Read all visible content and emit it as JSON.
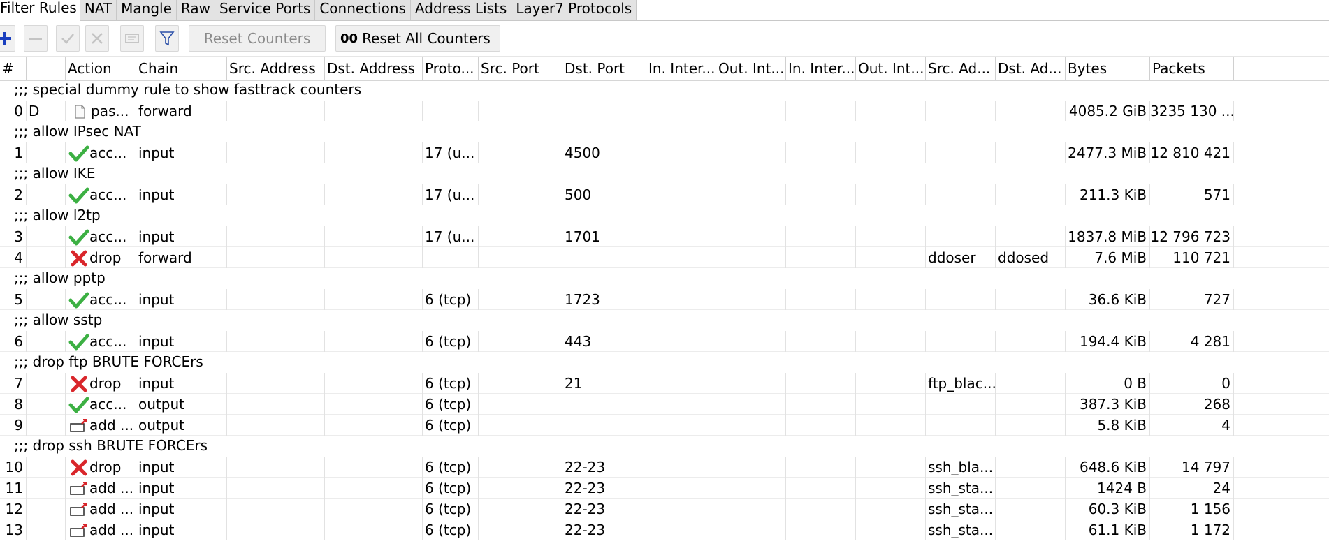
{
  "tabs": [
    "Filter Rules",
    "NAT",
    "Mangle",
    "Raw",
    "Service Ports",
    "Connections",
    "Address Lists",
    "Layer7 Protocols"
  ],
  "toolbar": {
    "reset_counters": "Reset Counters",
    "reset_all_counters_prefix": "00",
    "reset_all_counters": "Reset All Counters"
  },
  "columns": [
    "#",
    "",
    "Action",
    "Chain",
    "Src. Address",
    "Dst. Address",
    "Proto...",
    "Src. Port",
    "Dst. Port",
    "In. Inter...",
    "Out. Int...",
    "In. Inter...",
    "Out. Int...",
    "Src. Ad...",
    "Dst. Ad...",
    "Bytes",
    "Packets"
  ],
  "rows": [
    {
      "kind": "comment",
      "text": ";;; special dummy rule to show fasttrack counters"
    },
    {
      "kind": "rule",
      "num": "0",
      "flag": "D",
      "icon": "passthrough-icon",
      "action": "pas...",
      "chain": "forward",
      "proto": "",
      "dst_port": "",
      "src_list": "",
      "dst_list": "",
      "bytes": "4085.2 GiB",
      "packets": "3235 130 ...",
      "sep": true
    },
    {
      "kind": "comment",
      "text": ";;; allow IPsec NAT"
    },
    {
      "kind": "rule",
      "num": "1",
      "flag": "",
      "icon": "accept-icon",
      "action": "acc...",
      "chain": "input",
      "proto": "17 (u...",
      "dst_port": "4500",
      "src_list": "",
      "dst_list": "",
      "bytes": "2477.3 MiB",
      "packets": "12 810 421"
    },
    {
      "kind": "comment",
      "text": ";;; allow IKE"
    },
    {
      "kind": "rule",
      "num": "2",
      "flag": "",
      "icon": "accept-icon",
      "action": "acc...",
      "chain": "input",
      "proto": "17 (u...",
      "dst_port": "500",
      "src_list": "",
      "dst_list": "",
      "bytes": "211.3 KiB",
      "packets": "571"
    },
    {
      "kind": "comment",
      "text": ";;; allow l2tp"
    },
    {
      "kind": "rule",
      "num": "3",
      "flag": "",
      "icon": "accept-icon",
      "action": "acc...",
      "chain": "input",
      "proto": "17 (u...",
      "dst_port": "1701",
      "src_list": "",
      "dst_list": "",
      "bytes": "1837.8 MiB",
      "packets": "12 796 723"
    },
    {
      "kind": "rule",
      "num": "4",
      "flag": "",
      "icon": "drop-icon",
      "action": "drop",
      "chain": "forward",
      "proto": "",
      "dst_port": "",
      "src_list": "ddoser",
      "dst_list": "ddosed",
      "bytes": "7.6 MiB",
      "packets": "110 721"
    },
    {
      "kind": "comment",
      "text": ";;; allow pptp"
    },
    {
      "kind": "rule",
      "num": "5",
      "flag": "",
      "icon": "accept-icon",
      "action": "acc...",
      "chain": "input",
      "proto": "6 (tcp)",
      "dst_port": "1723",
      "src_list": "",
      "dst_list": "",
      "bytes": "36.6 KiB",
      "packets": "727"
    },
    {
      "kind": "comment",
      "text": ";;; allow sstp"
    },
    {
      "kind": "rule",
      "num": "6",
      "flag": "",
      "icon": "accept-icon",
      "action": "acc...",
      "chain": "input",
      "proto": "6 (tcp)",
      "dst_port": "443",
      "src_list": "",
      "dst_list": "",
      "bytes": "194.4 KiB",
      "packets": "4 281"
    },
    {
      "kind": "comment",
      "text": ";;; drop ftp BRUTE FORCErs"
    },
    {
      "kind": "rule",
      "num": "7",
      "flag": "",
      "icon": "drop-icon",
      "action": "drop",
      "chain": "input",
      "proto": "6 (tcp)",
      "dst_port": "21",
      "src_list": "ftp_blac...",
      "dst_list": "",
      "bytes": "0 B",
      "packets": "0"
    },
    {
      "kind": "rule",
      "num": "8",
      "flag": "",
      "icon": "accept-icon",
      "action": "acc...",
      "chain": "output",
      "proto": "6 (tcp)",
      "dst_port": "",
      "src_list": "",
      "dst_list": "",
      "bytes": "387.3 KiB",
      "packets": "268"
    },
    {
      "kind": "rule",
      "num": "9",
      "flag": "",
      "icon": "add-to-list-icon",
      "action": "add ...",
      "chain": "output",
      "proto": "6 (tcp)",
      "dst_port": "",
      "src_list": "",
      "dst_list": "",
      "bytes": "5.8 KiB",
      "packets": "4"
    },
    {
      "kind": "comment",
      "text": ";;; drop ssh BRUTE FORCErs"
    },
    {
      "kind": "rule",
      "num": "10",
      "flag": "",
      "icon": "drop-icon",
      "action": "drop",
      "chain": "input",
      "proto": "6 (tcp)",
      "dst_port": "22-23",
      "src_list": "ssh_bla...",
      "dst_list": "",
      "bytes": "648.6 KiB",
      "packets": "14 797"
    },
    {
      "kind": "rule",
      "num": "11",
      "flag": "",
      "icon": "add-to-list-icon",
      "action": "add ...",
      "chain": "input",
      "proto": "6 (tcp)",
      "dst_port": "22-23",
      "src_list": "ssh_sta...",
      "dst_list": "",
      "bytes": "1424 B",
      "packets": "24"
    },
    {
      "kind": "rule",
      "num": "12",
      "flag": "",
      "icon": "add-to-list-icon",
      "action": "add ...",
      "chain": "input",
      "proto": "6 (tcp)",
      "dst_port": "22-23",
      "src_list": "ssh_sta...",
      "dst_list": "",
      "bytes": "60.3 KiB",
      "packets": "1 156"
    },
    {
      "kind": "rule",
      "num": "13",
      "flag": "",
      "icon": "add-to-list-icon",
      "action": "add ...",
      "chain": "input",
      "proto": "6 (tcp)",
      "dst_port": "22-23",
      "src_list": "ssh_sta...",
      "dst_list": "",
      "bytes": "61.1 KiB",
      "packets": "1 172"
    }
  ],
  "colors": {
    "accept": "#3cb043",
    "drop": "#d9262b",
    "add": "#d9262b",
    "add_icon": "#1a56c9"
  }
}
